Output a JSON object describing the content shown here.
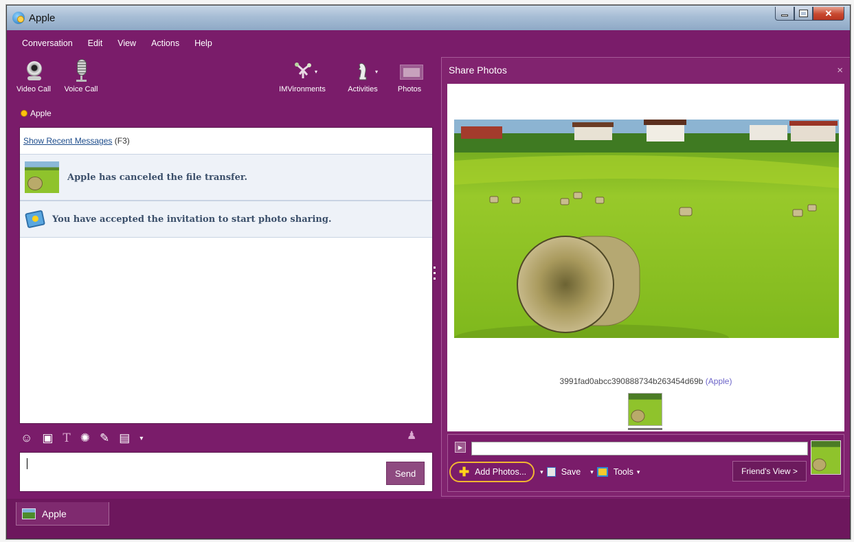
{
  "window": {
    "title": "Apple"
  },
  "menu": [
    "Conversation",
    "Edit",
    "View",
    "Actions",
    "Help"
  ],
  "toolbar": {
    "video_call": "Video Call",
    "voice_call": "Voice Call",
    "imvironments": "IMVironments",
    "activities": "Activities",
    "photos": "Photos"
  },
  "contact": {
    "name": "Apple",
    "status_color": "#ffc20e"
  },
  "conversation": {
    "recent_link": "Show Recent Messages",
    "recent_hint": "(F3)",
    "messages": [
      {
        "text": "Apple has canceled the file transfer.",
        "icon": "hay-bale-photo-thumbnail"
      },
      {
        "text": "You have accepted the invitation to start photo sharing.",
        "icon": "photo-share-icon"
      }
    ]
  },
  "compose": {
    "send_label": "Send",
    "value": ""
  },
  "share_photos": {
    "title": "Share Photos",
    "close_glyph": "×",
    "caption_name": "3991fad0abcc390888734b263454d69b",
    "caption_owner": "(Apple)",
    "add_photos": "Add Photos...",
    "save": "Save",
    "tools": "Tools",
    "friends_view": "Friend's View >"
  },
  "tab": {
    "label": "Apple"
  },
  "colors": {
    "accent": "#7a1c6a",
    "highlight": "#f2b631"
  }
}
